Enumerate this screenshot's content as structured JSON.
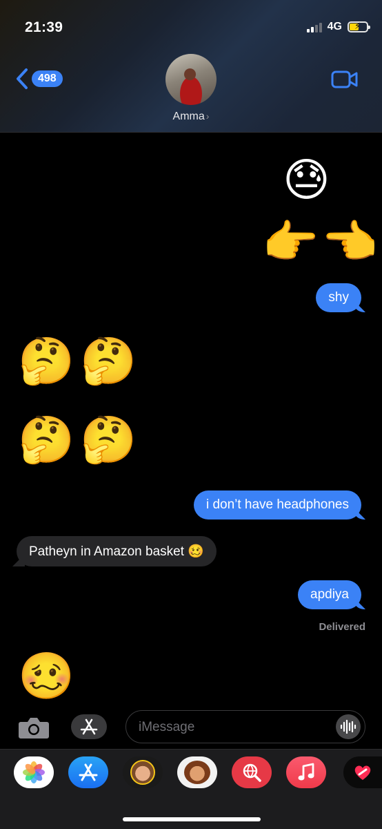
{
  "status_bar": {
    "time": "21:39",
    "network": "4G"
  },
  "header": {
    "back_count": "498",
    "contact_name": "Amma"
  },
  "messages": [
    {
      "type": "emoji",
      "side": "right",
      "content": "😓"
    },
    {
      "type": "emoji",
      "side": "right",
      "content": "👉👈"
    },
    {
      "type": "text",
      "side": "right",
      "content": "shy"
    },
    {
      "type": "emoji",
      "side": "left",
      "content": "🤔🤔"
    },
    {
      "type": "emoji",
      "side": "left",
      "content": "🤔🤔"
    },
    {
      "type": "text",
      "side": "right",
      "content": "i don’t have headphones"
    },
    {
      "type": "text",
      "side": "left",
      "content": "Patheyn in Amazon basket 🥴"
    },
    {
      "type": "text",
      "side": "right",
      "content": "apdiya"
    },
    {
      "type": "emoji",
      "side": "left",
      "content": "🥴"
    }
  ],
  "delivery_status": "Delivered",
  "input": {
    "placeholder": "iMessage",
    "value": ""
  },
  "app_drawer": [
    {
      "name": "Photos",
      "icon": "photos-icon"
    },
    {
      "name": "App Store",
      "icon": "app-store-icon"
    },
    {
      "name": "Memoji",
      "icon": "memoji-icon"
    },
    {
      "name": "Memoji Stickers",
      "icon": "memoji-stickers-icon"
    },
    {
      "name": "Images Search",
      "icon": "globe-search-icon"
    },
    {
      "name": "Music",
      "icon": "music-icon"
    },
    {
      "name": "Digital Touch",
      "icon": "digital-touch-icon"
    }
  ],
  "colors": {
    "sent_bubble": "#3b82f6",
    "received_bubble": "#262628",
    "accent": "#3b82f6"
  }
}
